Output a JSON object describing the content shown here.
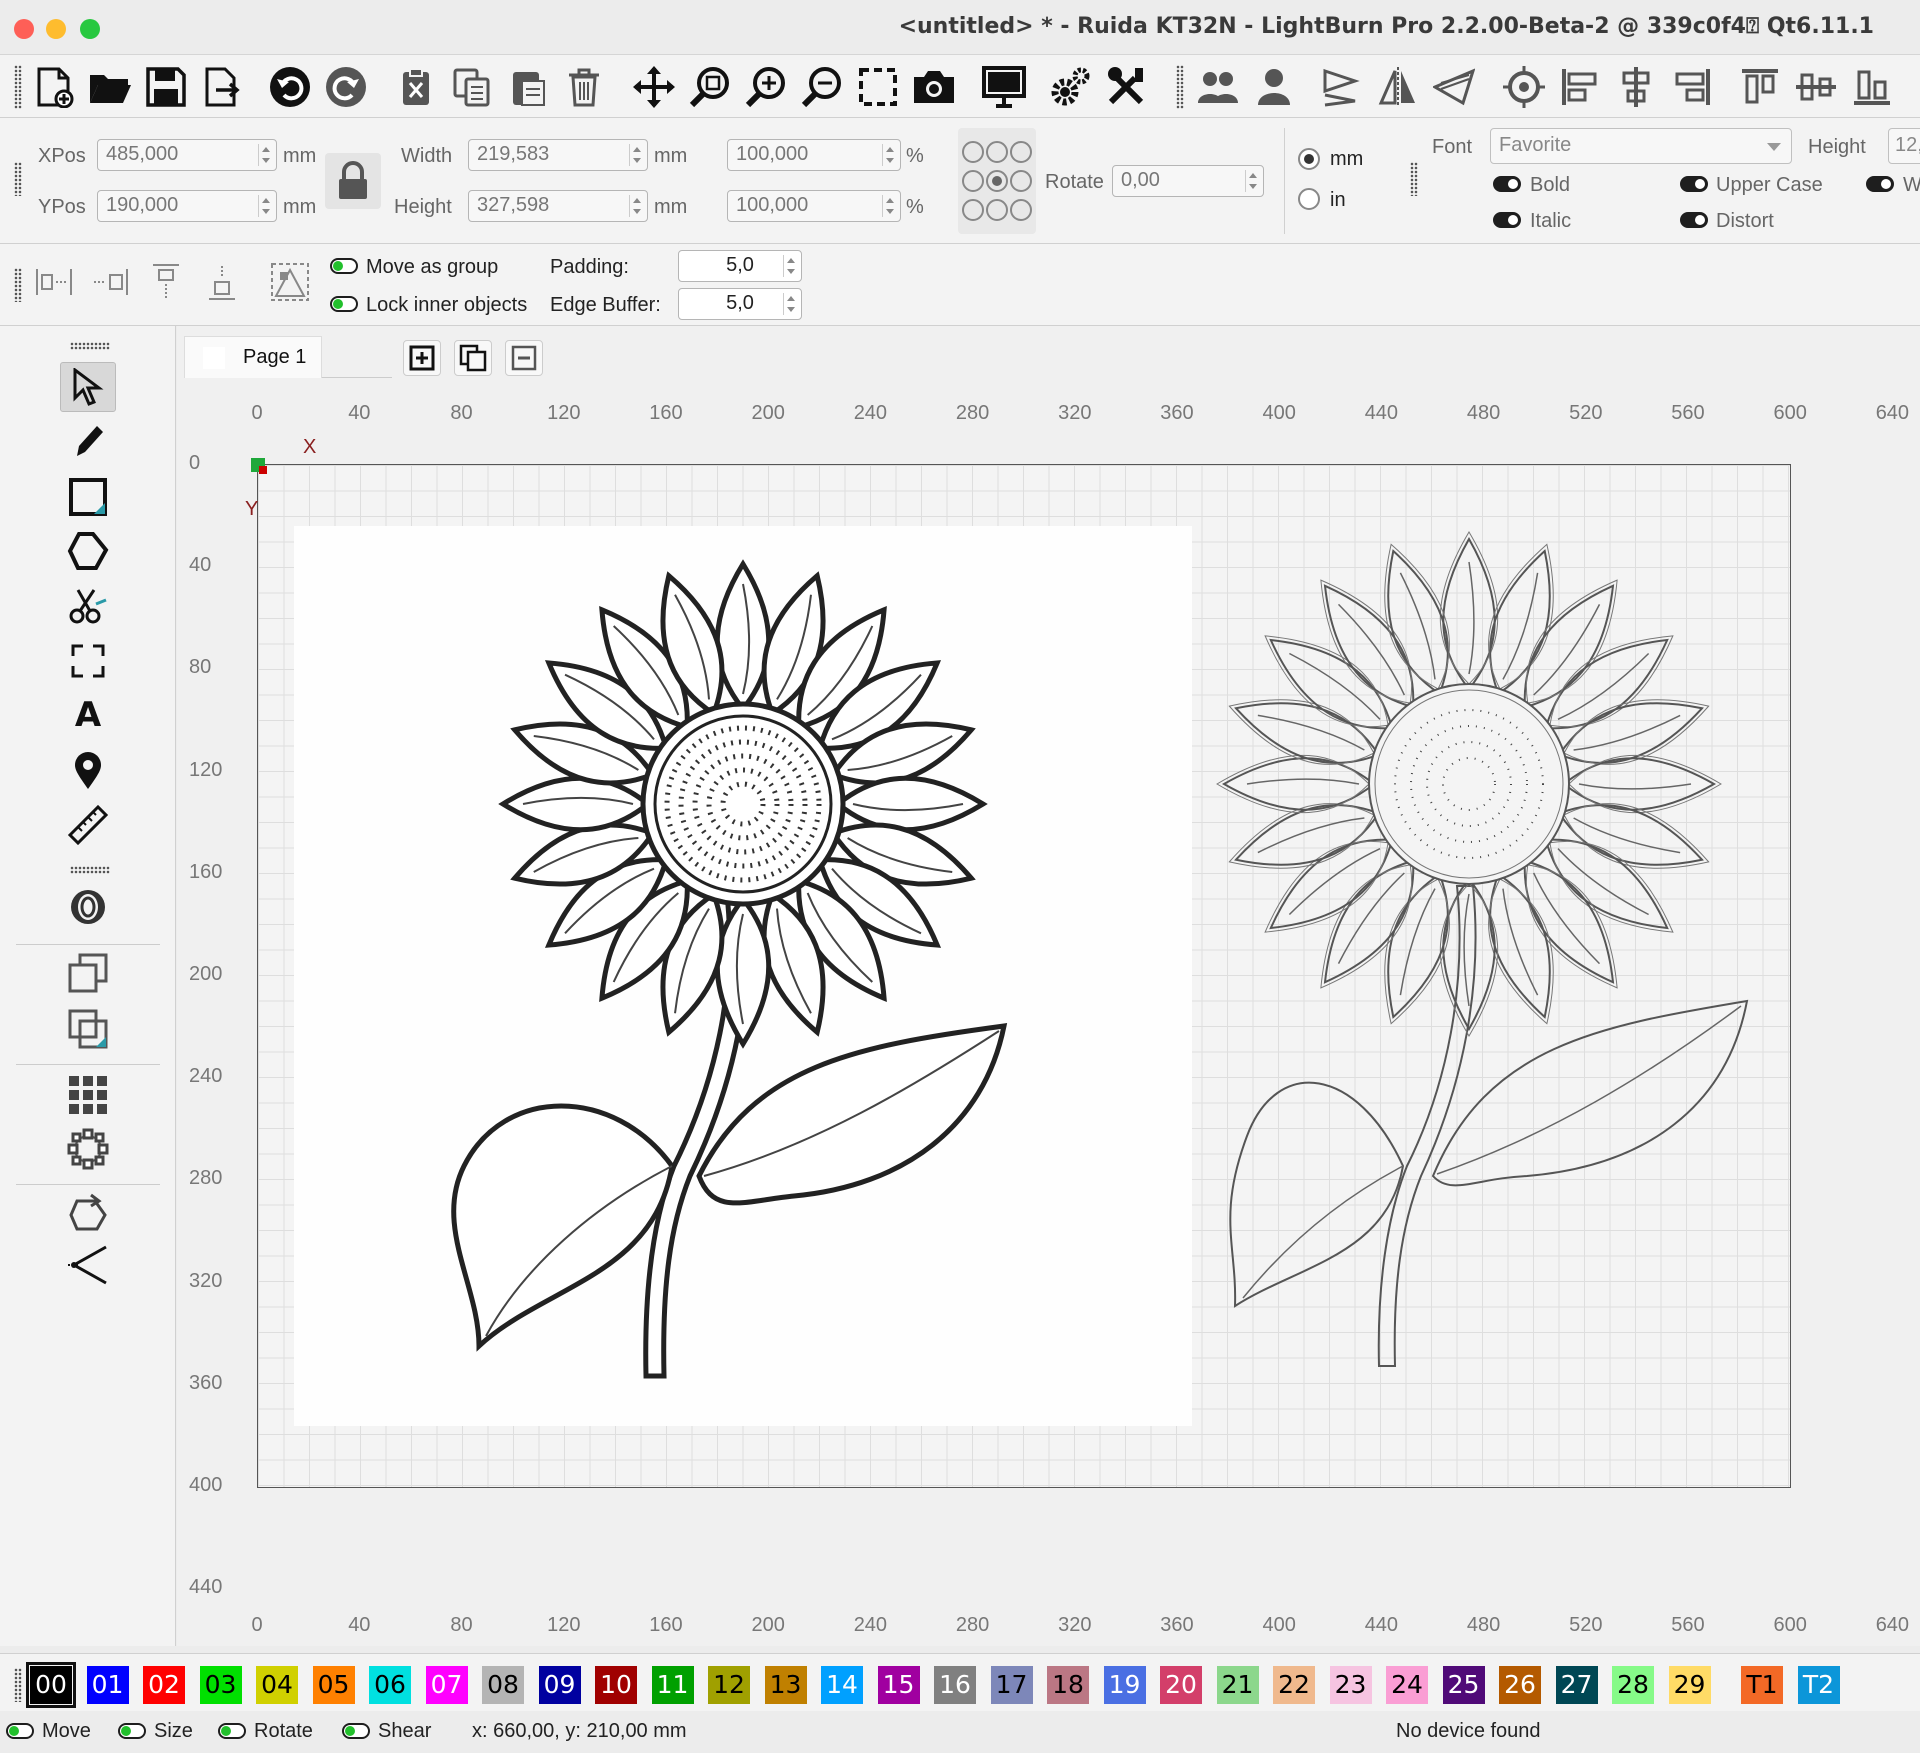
{
  "window": {
    "title": "<untitled> * - Ruida KT32N - LightBurn Pro 2.2.00-Beta-2 @ 339c0f4⍰ Qt6.11.1"
  },
  "position": {
    "xpos_label": "XPos",
    "xpos_value": "485,000",
    "xpos_unit": "mm",
    "ypos_label": "YPos",
    "ypos_value": "190,000",
    "ypos_unit": "mm",
    "width_label": "Width",
    "width_value": "219,583",
    "width_unit": "mm",
    "height_label": "Height",
    "height_value": "327,598",
    "height_unit": "mm",
    "scale_x": "100,000",
    "scale_y": "100,000",
    "pct": "%",
    "rotate_label": "Rotate",
    "rotate_value": "0,00",
    "unit_mm": "mm",
    "unit_in": "in",
    "unit_selected": "mm"
  },
  "font": {
    "font_label": "Font",
    "font_value": "Favorite",
    "height_label": "Height",
    "height_value": "12,",
    "bold": "Bold",
    "italic": "Italic",
    "upper_case": "Upper Case",
    "distort": "Distort",
    "w_cut": "W"
  },
  "arrange": {
    "move_as_group": "Move as group",
    "lock_inner": "Lock inner objects",
    "padding_label": "Padding:",
    "padding_value": "5,0",
    "edge_label": "Edge Buffer:",
    "edge_value": "5,0"
  },
  "tabs": {
    "page1": "Page 1"
  },
  "ruler": {
    "x_ticks": [
      "0",
      "40",
      "80",
      "120",
      "160",
      "200",
      "240",
      "280",
      "320",
      "360",
      "400",
      "440",
      "480",
      "520",
      "560",
      "600",
      "640"
    ],
    "y_ticks": [
      "0",
      "40",
      "80",
      "120",
      "160",
      "200",
      "240",
      "280",
      "320",
      "360",
      "400",
      "440"
    ],
    "x_axis": "X",
    "y_axis": "Y"
  },
  "layers": [
    {
      "label": "00",
      "color": "#000000",
      "text": "#ffffff"
    },
    {
      "label": "01",
      "color": "#0000ff",
      "text": "#ffffff"
    },
    {
      "label": "02",
      "color": "#ff0000",
      "text": "#ffffff"
    },
    {
      "label": "03",
      "color": "#00e000",
      "text": "#000000"
    },
    {
      "label": "04",
      "color": "#d0d000",
      "text": "#000000"
    },
    {
      "label": "05",
      "color": "#ff8000",
      "text": "#000000"
    },
    {
      "label": "06",
      "color": "#00e0e0",
      "text": "#000000"
    },
    {
      "label": "07",
      "color": "#ff00ff",
      "text": "#ffffff"
    },
    {
      "label": "08",
      "color": "#b4b4b4",
      "text": "#000000"
    },
    {
      "label": "09",
      "color": "#0000a0",
      "text": "#ffffff"
    },
    {
      "label": "10",
      "color": "#a00000",
      "text": "#ffffff"
    },
    {
      "label": "11",
      "color": "#00a000",
      "text": "#ffffff"
    },
    {
      "label": "12",
      "color": "#a0a000",
      "text": "#000000"
    },
    {
      "label": "13",
      "color": "#c08000",
      "text": "#000000"
    },
    {
      "label": "14",
      "color": "#00a0ff",
      "text": "#ffffff"
    },
    {
      "label": "15",
      "color": "#a000a0",
      "text": "#ffffff"
    },
    {
      "label": "16",
      "color": "#808080",
      "text": "#ffffff"
    },
    {
      "label": "17",
      "color": "#7d87b9",
      "text": "#000000"
    },
    {
      "label": "18",
      "color": "#bb7784",
      "text": "#000000"
    },
    {
      "label": "19",
      "color": "#4a6fe3",
      "text": "#ffffff"
    },
    {
      "label": "20",
      "color": "#d33f6a",
      "text": "#ffffff"
    },
    {
      "label": "21",
      "color": "#8cd78c",
      "text": "#000000"
    },
    {
      "label": "22",
      "color": "#f0b98d",
      "text": "#000000"
    },
    {
      "label": "23",
      "color": "#f6c4e1",
      "text": "#000000"
    },
    {
      "label": "24",
      "color": "#fa9ed4",
      "text": "#000000"
    },
    {
      "label": "25",
      "color": "#500a78",
      "text": "#ffffff"
    },
    {
      "label": "26",
      "color": "#b45a00",
      "text": "#ffffff"
    },
    {
      "label": "27",
      "color": "#004754",
      "text": "#ffffff"
    },
    {
      "label": "28",
      "color": "#86fa88",
      "text": "#000000"
    },
    {
      "label": "29",
      "color": "#ffdb66",
      "text": "#000000"
    },
    {
      "label": "T1",
      "color": "#f36926",
      "text": "#000000"
    },
    {
      "label": "T2",
      "color": "#0c96d9",
      "text": "#ffffff"
    }
  ],
  "status": {
    "move": "Move",
    "size": "Size",
    "rotate": "Rotate",
    "shear": "Shear",
    "coords": "x: 660,00, y: 210,00 mm",
    "device": "No device found"
  }
}
